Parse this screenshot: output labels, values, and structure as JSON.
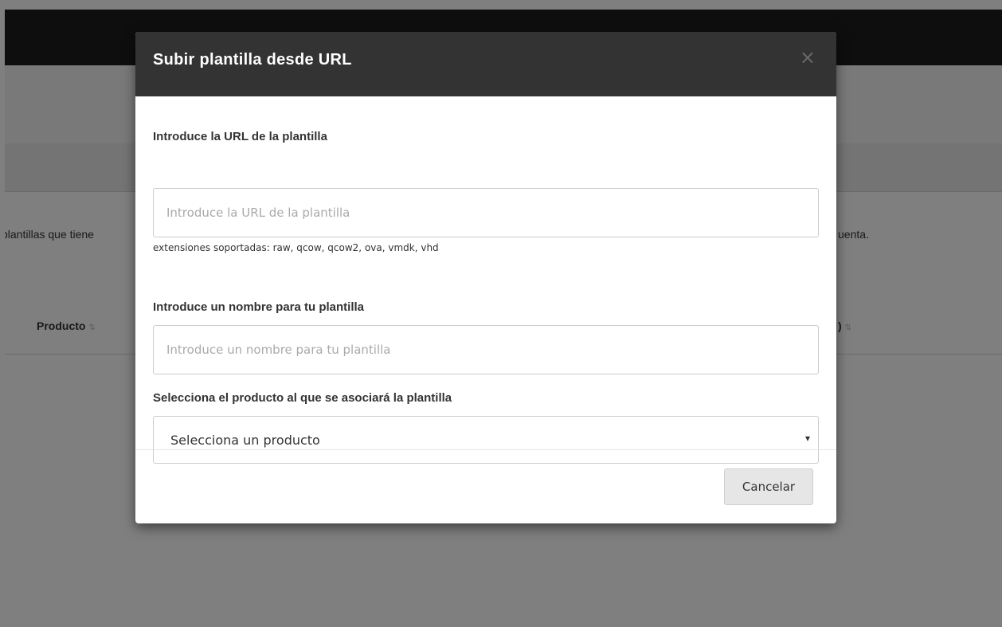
{
  "background": {
    "intro_left": "plantillas que tiene",
    "intro_right": "uenta.",
    "table": {
      "col_product": "Producto",
      "col_right": ")"
    }
  },
  "modal": {
    "title": "Subir plantilla desde URL",
    "close_glyph": "×",
    "url_field": {
      "label": "Introduce la URL de la plantilla",
      "placeholder": "Introduce la URL de la plantilla",
      "value": "",
      "help": "extensiones soportadas: raw, qcow, qcow2, ova, vmdk, vhd"
    },
    "name_field": {
      "label": "Introduce un nombre para tu plantilla",
      "placeholder": "Introduce un nombre para tu plantilla",
      "value": ""
    },
    "product_field": {
      "label": "Selecciona el producto al que se asociará la plantilla",
      "selected": "Selecciona un producto",
      "caret": "▾"
    },
    "cancel_label": "Cancelar"
  },
  "icons": {
    "sort": "sort-icon",
    "close": "close-icon",
    "dropdown": "chevron-down-icon"
  },
  "colors": {
    "modal_header": "#333333",
    "topbar": "#1d1d1d",
    "backdrop": "rgba(0,0,0,0.5)",
    "cancel_button": "#e6e6e6"
  }
}
